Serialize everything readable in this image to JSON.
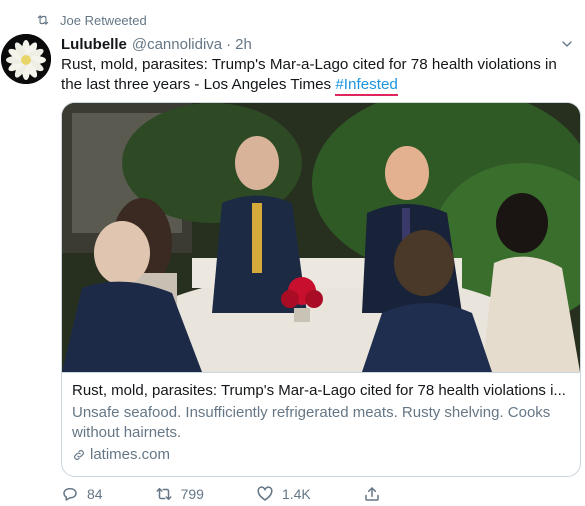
{
  "retweet": {
    "label": "Joe Retweeted",
    "icon": "retweet-icon"
  },
  "tweet": {
    "author_name": "Lulubelle",
    "author_handle": "@cannolidiva",
    "separator": "·",
    "time": "2h",
    "text_before": "Rust, mold, parasites: Trump's Mar-a-Lago cited for 78 health violations in the last three years - Los Angeles Times ",
    "hashtag": "#Infested"
  },
  "card": {
    "title": "Rust, mold, parasites: Trump's Mar-a-Lago cited for 78 health violations i...",
    "description": "Unsafe seafood. Insufficiently refrigerated meats. Rusty shelving. Cooks without hairnets.",
    "domain": "latimes.com"
  },
  "actions": {
    "reply_count": "84",
    "retweet_count": "799",
    "like_count": "1.4K"
  },
  "colors": {
    "link": "#1b95e0",
    "muted": "#657786",
    "hashtag_underline": "#e0245e"
  }
}
